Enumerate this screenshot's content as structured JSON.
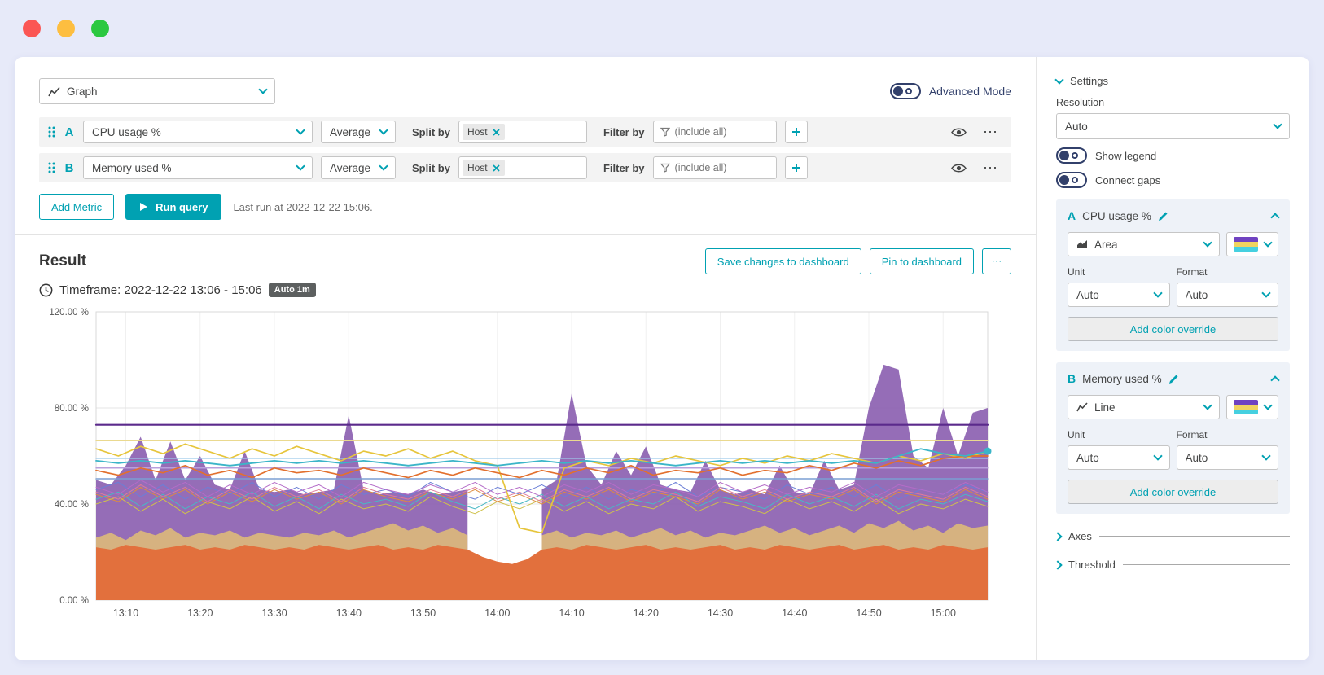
{
  "window": {
    "controls": [
      "close",
      "minimize",
      "maximize"
    ]
  },
  "toolbar": {
    "visualization_label": "Graph",
    "advanced_mode_label": "Advanced Mode"
  },
  "ui": {
    "more": "⋯",
    "plus": "+"
  },
  "queries": [
    {
      "letter": "A",
      "metric": "CPU usage %",
      "aggregation": "Average",
      "split_by_label": "Split by",
      "split_chip": "Host",
      "filter_by_label": "Filter by",
      "filter_placeholder": "(include all)"
    },
    {
      "letter": "B",
      "metric": "Memory used %",
      "aggregation": "Average",
      "split_by_label": "Split by",
      "split_chip": "Host",
      "filter_by_label": "Filter by",
      "filter_placeholder": "(include all)"
    }
  ],
  "actions": {
    "add_metric": "Add Metric",
    "run_query": "Run query",
    "last_run": "Last run at 2022-12-22 15:06."
  },
  "result": {
    "title": "Result",
    "save_button": "Save changes to dashboard",
    "pin_button": "Pin to dashboard",
    "timeframe": "Timeframe: 2022-12-22 13:06 - 15:06",
    "resolution_badge": "Auto 1m"
  },
  "settings": {
    "title": "Settings",
    "resolution_label": "Resolution",
    "resolution_value": "Auto",
    "show_legend_label": "Show legend",
    "connect_gaps_label": "Connect gaps",
    "metric_cards": [
      {
        "letter": "A",
        "title": "CPU usage %",
        "viz_type": "Area",
        "unit_label": "Unit",
        "format_label": "Format",
        "unit_value": "Auto",
        "format_value": "Auto",
        "override_button": "Add color override"
      },
      {
        "letter": "B",
        "title": "Memory used %",
        "viz_type": "Line",
        "unit_label": "Unit",
        "format_label": "Format",
        "unit_value": "Auto",
        "format_value": "Auto",
        "override_button": "Add color override"
      }
    ],
    "axes_label": "Axes",
    "threshold_label": "Threshold"
  },
  "colors": {
    "accent_teal": "#00a1b2",
    "dark_navy": "#32406b",
    "text": "#454646",
    "swatch_stripes": [
      "#6f42c1",
      "#f0d35f",
      "#45d0e0"
    ],
    "badge_bg": "#5c5f5f"
  },
  "chart_data": {
    "type": "area",
    "title": "",
    "xlabel": "",
    "ylabel": "",
    "legend": false,
    "grid": true,
    "xlim": [
      0,
      120
    ],
    "ylim": [
      0,
      120
    ],
    "x_unit": "minutes after 13:06 on 2022-12-22",
    "x_ticks": [
      {
        "t": 4,
        "label": "13:10"
      },
      {
        "t": 14,
        "label": "13:20"
      },
      {
        "t": 24,
        "label": "13:30"
      },
      {
        "t": 34,
        "label": "13:40"
      },
      {
        "t": 44,
        "label": "13:50"
      },
      {
        "t": 54,
        "label": "14:00"
      },
      {
        "t": 64,
        "label": "14:10"
      },
      {
        "t": 74,
        "label": "14:20"
      },
      {
        "t": 84,
        "label": "14:30"
      },
      {
        "t": 94,
        "label": "14:40"
      },
      {
        "t": 104,
        "label": "14:50"
      },
      {
        "t": 114,
        "label": "15:00"
      }
    ],
    "y_ticks": [
      {
        "v": 0,
        "label": "0.00 %"
      },
      {
        "v": 40,
        "label": "40.00 %"
      },
      {
        "v": 80,
        "label": "80.00 %"
      },
      {
        "v": 120,
        "label": "120.00 %"
      }
    ],
    "series": [
      {
        "name": "cpu-usage-area-host1",
        "kind": "area",
        "color": "#8f65b3",
        "opacity": 0.95,
        "step": 2,
        "values": [
          50,
          48,
          56,
          68,
          50,
          66,
          50,
          60,
          48,
          46,
          62,
          46,
          45,
          46,
          44,
          45,
          46,
          77,
          46,
          44,
          45,
          44,
          46,
          44,
          45,
          46,
          null,
          null,
          null,
          null,
          46,
          50,
          86,
          56,
          48,
          62,
          52,
          64,
          48,
          46,
          45,
          58,
          46,
          44,
          46,
          44,
          56,
          45,
          44,
          58,
          46,
          48,
          80,
          98,
          96,
          60,
          55,
          80,
          60,
          78,
          80
        ]
      },
      {
        "name": "cpu-usage-area-host2-tan",
        "kind": "area",
        "color": "#d9b67c",
        "opacity": 0.95,
        "step": 2,
        "values": [
          26,
          28,
          25,
          29,
          27,
          30,
          26,
          28,
          27,
          29,
          26,
          28,
          27,
          26,
          28,
          27,
          29,
          26,
          28,
          30,
          32,
          29,
          31,
          28,
          30,
          27,
          null,
          null,
          null,
          null,
          27,
          29,
          26,
          28,
          27,
          29,
          26,
          28,
          30,
          27,
          29,
          26,
          28,
          27,
          29,
          31,
          28,
          30,
          27,
          29,
          31,
          28,
          32,
          30,
          33,
          29,
          31,
          28,
          32,
          30,
          31
        ]
      },
      {
        "name": "cpu-usage-area-host3-orange",
        "kind": "area",
        "color": "#e2703d",
        "opacity": 1,
        "step": 2,
        "values": [
          22,
          21,
          23,
          22,
          21,
          22,
          23,
          21,
          22,
          21,
          23,
          22,
          21,
          22,
          21,
          23,
          22,
          21,
          22,
          23,
          21,
          22,
          21,
          23,
          22,
          21,
          18,
          16,
          15,
          17,
          21,
          22,
          21,
          23,
          22,
          21,
          22,
          23,
          21,
          22,
          21,
          22,
          23,
          21,
          22,
          21,
          23,
          22,
          21,
          22,
          23,
          21,
          22,
          23,
          21,
          22,
          21,
          23,
          22,
          21,
          22
        ]
      },
      {
        "name": "noise-line-blue",
        "kind": "line",
        "color": "#6b7fd7",
        "width": 1,
        "step": 3,
        "values": [
          46,
          49,
          43,
          48,
          42,
          47,
          44,
          49,
          43,
          47,
          42,
          48,
          44,
          46,
          43,
          49,
          45,
          42,
          47,
          44,
          48,
          43,
          47,
          42,
          46,
          44,
          49,
          43,
          47,
          45,
          42,
          48,
          44,
          47,
          43,
          48,
          42,
          46,
          44,
          48,
          45
        ]
      },
      {
        "name": "noise-line-orange",
        "kind": "line",
        "color": "#dd8b3f",
        "width": 1,
        "step": 3,
        "values": [
          44,
          41,
          47,
          42,
          46,
          40,
          45,
          41,
          46,
          42,
          45,
          40,
          46,
          43,
          41,
          45,
          42,
          46,
          41,
          44,
          40,
          45,
          42,
          46,
          41,
          45,
          43,
          40,
          46,
          42,
          45,
          41,
          44,
          42,
          46,
          40,
          45,
          43,
          41,
          46,
          42
        ]
      },
      {
        "name": "noise-line-teal",
        "kind": "line",
        "color": "#49b8c4",
        "width": 1,
        "step": 3,
        "values": [
          42,
          45,
          39,
          44,
          38,
          43,
          40,
          45,
          39,
          43,
          38,
          44,
          40,
          42,
          39,
          45,
          41,
          38,
          43,
          40,
          44,
          39,
          43,
          38,
          42,
          40,
          45,
          39,
          43,
          41,
          38,
          44,
          40,
          43,
          39,
          44,
          38,
          42,
          40,
          44,
          41
        ]
      },
      {
        "name": "noise-line-purple",
        "kind": "line",
        "color": "#b56cc8",
        "width": 1,
        "step": 3,
        "values": [
          47,
          44,
          50,
          45,
          49,
          43,
          48,
          44,
          49,
          45,
          48,
          43,
          49,
          46,
          44,
          48,
          45,
          49,
          44,
          47,
          43,
          48,
          45,
          49,
          44,
          48,
          46,
          43,
          49,
          45,
          48,
          44,
          47,
          45,
          49,
          43,
          48,
          46,
          44,
          49,
          45
        ]
      },
      {
        "name": "noise-line-olive",
        "kind": "line",
        "color": "#cfc14a",
        "width": 1,
        "step": 3,
        "values": [
          40,
          43,
          37,
          42,
          36,
          41,
          38,
          43,
          37,
          41,
          36,
          42,
          38,
          40,
          37,
          43,
          39,
          36,
          41,
          38,
          42,
          37,
          41,
          36,
          40,
          38,
          43,
          37,
          41,
          39,
          36,
          42,
          38,
          41,
          37,
          42,
          36,
          40,
          38,
          42,
          39
        ]
      },
      {
        "name": "noise-line-pink",
        "kind": "line",
        "color": "#e07a9a",
        "width": 1,
        "step": 3,
        "values": [
          45,
          42,
          48,
          43,
          47,
          41,
          46,
          42,
          47,
          43,
          46,
          41,
          47,
          44,
          42,
          46,
          43,
          47,
          42,
          45,
          41,
          46,
          43,
          47,
          42,
          46,
          44,
          41,
          47,
          43,
          46,
          42,
          45,
          43,
          47,
          41,
          46,
          44,
          42,
          47,
          43
        ]
      },
      {
        "name": "flat-line-pale-yellow",
        "kind": "line",
        "color": "#ead98f",
        "width": 1.5,
        "step": 120,
        "values": [
          66.5,
          66.5
        ]
      },
      {
        "name": "flat-line-light-blue",
        "kind": "line",
        "color": "#9ec9ea",
        "width": 1.5,
        "step": 120,
        "values": [
          59,
          59
        ]
      },
      {
        "name": "flat-line-lavender",
        "kind": "line",
        "color": "#b9a0dc",
        "width": 1.5,
        "step": 120,
        "values": [
          55,
          55
        ]
      },
      {
        "name": "flat-line-steel-blue",
        "kind": "line",
        "color": "#7b9fd4",
        "width": 1.5,
        "step": 120,
        "values": [
          50.5,
          50.5
        ]
      },
      {
        "name": "memory-line-yellow",
        "kind": "line",
        "color": "#e6c53c",
        "width": 1.7,
        "step": 3,
        "values": [
          63,
          60,
          64,
          61,
          65,
          62,
          59,
          63,
          60,
          64,
          61,
          58,
          62,
          60,
          63,
          59,
          62,
          58,
          56,
          30,
          28,
          55,
          58,
          56,
          59,
          57,
          60,
          58,
          56,
          59,
          57,
          60,
          58,
          61,
          59,
          57,
          60,
          58,
          61,
          59,
          62
        ]
      },
      {
        "name": "memory-line-orange",
        "kind": "line",
        "color": "#e2702e",
        "width": 1.7,
        "step": 3,
        "values": [
          54,
          52,
          55,
          53,
          56,
          52,
          54,
          51,
          55,
          53,
          54,
          52,
          55,
          53,
          51,
          54,
          52,
          55,
          53,
          51,
          54,
          52,
          55,
          53,
          56,
          52,
          54,
          53,
          55,
          52,
          54,
          53,
          56,
          54,
          57,
          55,
          58,
          56,
          59,
          60,
          60
        ]
      },
      {
        "name": "memory-line-teal",
        "kind": "line",
        "color": "#3bb5c8",
        "width": 1.8,
        "step": 3,
        "end_dot": true,
        "values": [
          58,
          57,
          58,
          57,
          58,
          57,
          56,
          57,
          58,
          57,
          58,
          57,
          58,
          57,
          56,
          57,
          58,
          57,
          56,
          57,
          58,
          57,
          58,
          57,
          58,
          57,
          56,
          57,
          58,
          57,
          58,
          57,
          58,
          57,
          58,
          57,
          60,
          63,
          61,
          60,
          62
        ]
      },
      {
        "name": "memory-line-dark-purple",
        "kind": "line",
        "color": "#5b2a8c",
        "width": 2.2,
        "step": 120,
        "values": [
          73,
          73
        ]
      }
    ]
  }
}
